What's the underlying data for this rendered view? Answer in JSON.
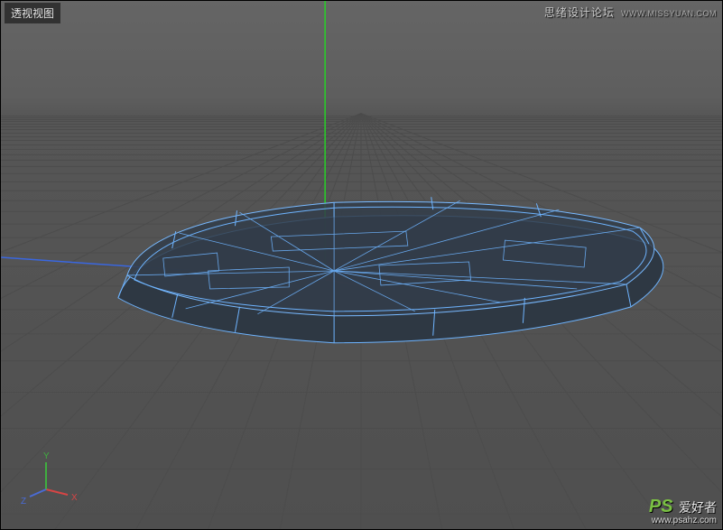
{
  "viewport": {
    "name_label": "透视视图"
  },
  "watermarks": {
    "top_cn": "思绪设计论坛",
    "top_url": "WWW.MISSYUAN.COM",
    "bottom_brand": "PS",
    "bottom_cn": "爱好者",
    "bottom_url": "www.psahz.com"
  },
  "axis": {
    "x_label": "X",
    "y_label": "Y",
    "z_label": "Z",
    "x_color": "#d64545",
    "y_color": "#3fae3f",
    "z_color": "#4a6bd4"
  },
  "scene": {
    "grid_color": "#4a4a4a",
    "grid_minor": "#555555",
    "background": "#5a5a5a",
    "mesh_fill": "#2a3440",
    "mesh_edge": "#6eb4ff"
  }
}
